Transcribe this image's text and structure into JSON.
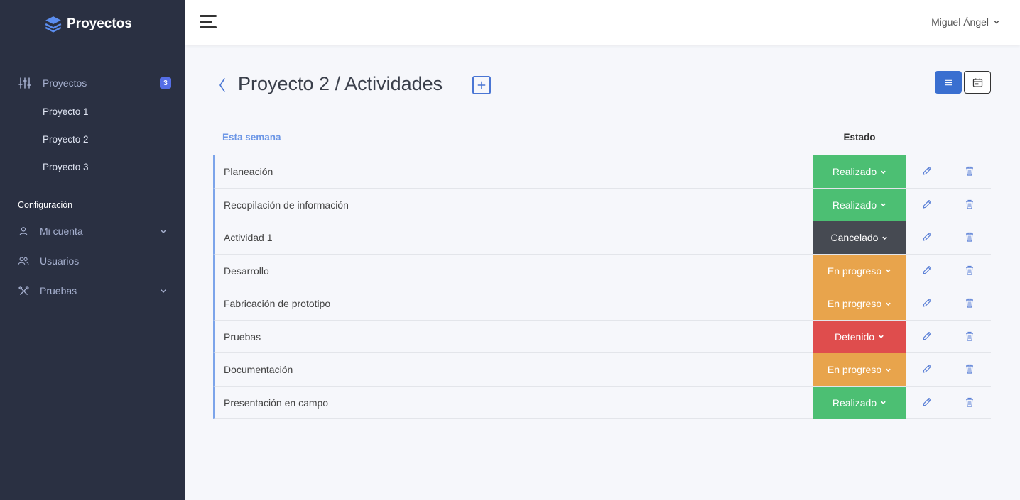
{
  "brand": {
    "name": "Proyectos"
  },
  "sidebar": {
    "projects_label": "Proyectos",
    "projects_count": "3",
    "sub_items": [
      "Proyecto 1",
      "Proyecto 2",
      "Proyecto 3"
    ],
    "config_title": "Configuración",
    "account_label": "Mi cuenta",
    "users_label": "Usuarios",
    "tests_label": "Pruebas"
  },
  "topbar": {
    "user_name": "Miguel Ángel"
  },
  "header": {
    "title": "Proyecto 2 / Actividades"
  },
  "table": {
    "col_week": "Esta semana",
    "col_status": "Estado",
    "rows": [
      {
        "name": "Planeación",
        "status": "Realizado",
        "color": "#4cbf73"
      },
      {
        "name": "Recopilación de información",
        "status": "Realizado",
        "color": "#4cbf73"
      },
      {
        "name": "Actividad 1",
        "status": "Cancelado",
        "color": "#464a52"
      },
      {
        "name": "Desarrollo",
        "status": "En progreso",
        "color": "#e8a44c"
      },
      {
        "name": "Fabricación de prototipo",
        "status": "En progreso",
        "color": "#e8a44c"
      },
      {
        "name": "Pruebas",
        "status": "Detenido",
        "color": "#df4d4d"
      },
      {
        "name": "Documentación",
        "status": "En progreso",
        "color": "#e8a44c"
      },
      {
        "name": "Presentación en campo",
        "status": "Realizado",
        "color": "#4cbf73"
      }
    ]
  },
  "colors": {
    "accent": "#3a6fd0",
    "sidebar_bg": "#2a3042"
  }
}
